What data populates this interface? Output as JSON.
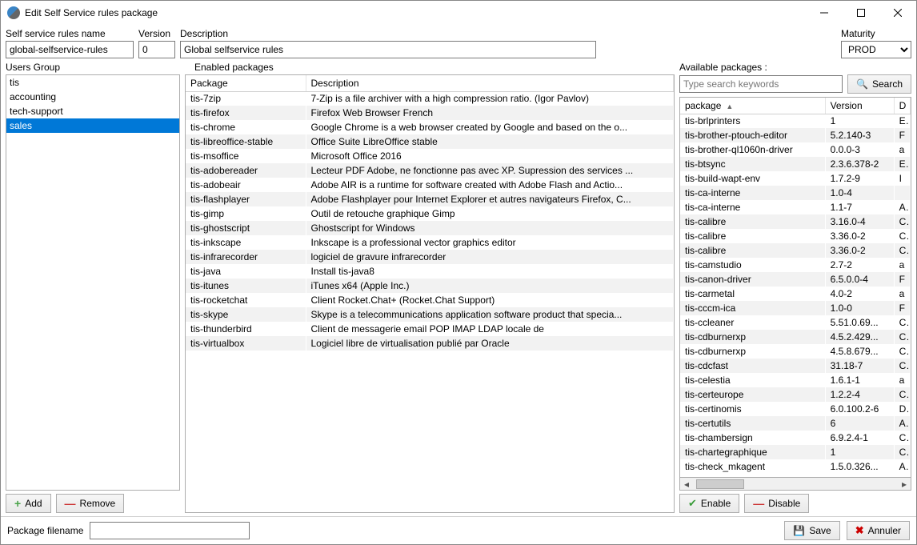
{
  "window": {
    "title": "Edit Self Service rules package"
  },
  "header": {
    "name_label": "Self service rules name",
    "name_value": "global-selfservice-rules",
    "version_label": "Version",
    "version_value": "0",
    "description_label": "Description",
    "description_value": "Global selfservice rules",
    "maturity_label": "Maturity",
    "maturity_value": "PROD"
  },
  "left": {
    "title": "Users Group",
    "items": [
      "tis",
      "accounting",
      "tech-support",
      "sales"
    ],
    "selected": "sales",
    "add_label": "Add",
    "remove_label": "Remove"
  },
  "mid": {
    "title": "Enabled packages",
    "col_package": "Package",
    "col_description": "Description",
    "rows": [
      {
        "p": "tis-7zip",
        "d": "7-Zip is a file archiver with a high compression ratio. (Igor Pavlov)"
      },
      {
        "p": "tis-firefox",
        "d": "Firefox Web Browser French"
      },
      {
        "p": "tis-chrome",
        "d": "Google Chrome is a web browser created by Google and based on the o..."
      },
      {
        "p": "tis-libreoffice-stable",
        "d": "Office Suite LibreOffice stable"
      },
      {
        "p": "tis-msoffice",
        "d": "Microsoft Office 2016"
      },
      {
        "p": "tis-adobereader",
        "d": "Lecteur PDF Adobe, ne fonctionne pas avec XP. Supression des services ..."
      },
      {
        "p": "tis-adobeair",
        "d": "Adobe AIR is a runtime for software created with Adobe Flash and Actio..."
      },
      {
        "p": "tis-flashplayer",
        "d": "Adobe Flashplayer pour Internet Explorer et autres navigateurs Firefox, C..."
      },
      {
        "p": "tis-gimp",
        "d": "Outil de retouche graphique Gimp"
      },
      {
        "p": "tis-ghostscript",
        "d": "Ghostscript for Windows"
      },
      {
        "p": "tis-inkscape",
        "d": "Inkscape is a professional vector graphics editor"
      },
      {
        "p": "tis-infrarecorder",
        "d": "logiciel de gravure infrarecorder"
      },
      {
        "p": "tis-java",
        "d": "Install tis-java8"
      },
      {
        "p": "tis-itunes",
        "d": "iTunes x64 (Apple Inc.)"
      },
      {
        "p": "tis-rocketchat",
        "d": "Client Rocket.Chat+ (Rocket.Chat Support)"
      },
      {
        "p": "tis-skype",
        "d": "Skype is a telecommunications application software product that specia..."
      },
      {
        "p": "tis-thunderbird",
        "d": "Client de messagerie email POP IMAP LDAP locale de"
      },
      {
        "p": "tis-virtualbox",
        "d": "Logiciel libre de virtualisation publié par Oracle"
      }
    ]
  },
  "right": {
    "title": "Available packages :",
    "search_placeholder": "Type search keywords",
    "search_label": "Search",
    "col_package": "package",
    "col_version": "Version",
    "col_d": "D",
    "rows": [
      {
        "p": "tis-brlprinters",
        "v": "1",
        "d": "E"
      },
      {
        "p": "tis-brother-ptouch-editor",
        "v": "5.2.140-3",
        "d": "F"
      },
      {
        "p": "tis-brother-ql1060n-driver",
        "v": "0.0.0-3",
        "d": "a"
      },
      {
        "p": "tis-btsync",
        "v": "2.3.6.378-2",
        "d": "E"
      },
      {
        "p": "tis-build-wapt-env",
        "v": "1.7.2-9",
        "d": "I"
      },
      {
        "p": "tis-ca-interne",
        "v": "1.0-4",
        "d": ""
      },
      {
        "p": "tis-ca-interne",
        "v": "1.1-7",
        "d": "A"
      },
      {
        "p": "tis-calibre",
        "v": "3.16.0-4",
        "d": "C"
      },
      {
        "p": "tis-calibre",
        "v": "3.36.0-2",
        "d": "C"
      },
      {
        "p": "tis-calibre",
        "v": "3.36.0-2",
        "d": "C"
      },
      {
        "p": "tis-camstudio",
        "v": "2.7-2",
        "d": "a"
      },
      {
        "p": "tis-canon-driver",
        "v": "6.5.0.0-4",
        "d": "F"
      },
      {
        "p": "tis-carmetal",
        "v": "4.0-2",
        "d": "a"
      },
      {
        "p": "tis-cccm-ica",
        "v": "1.0-0",
        "d": "F"
      },
      {
        "p": "tis-ccleaner",
        "v": "5.51.0.69...",
        "d": "C"
      },
      {
        "p": "tis-cdburnerxp",
        "v": "4.5.2.429...",
        "d": "C"
      },
      {
        "p": "tis-cdburnerxp",
        "v": "4.5.8.679...",
        "d": "C"
      },
      {
        "p": "tis-cdcfast",
        "v": "31.18-7",
        "d": "C"
      },
      {
        "p": "tis-celestia",
        "v": "1.6.1-1",
        "d": "a"
      },
      {
        "p": "tis-certeurope",
        "v": "1.2.2-4",
        "d": "C"
      },
      {
        "p": "tis-certinomis",
        "v": "6.0.100.2-6",
        "d": "D"
      },
      {
        "p": "tis-certutils",
        "v": "6",
        "d": "A"
      },
      {
        "p": "tis-chambersign",
        "v": "6.9.2.4-1",
        "d": "C"
      },
      {
        "p": "tis-chartegraphique",
        "v": "1",
        "d": "C"
      },
      {
        "p": "tis-check_mkagent",
        "v": "1.5.0.326...",
        "d": "A"
      }
    ],
    "enable_label": "Enable",
    "disable_label": "Disable"
  },
  "footer": {
    "pkg_filename_label": "Package filename",
    "pkg_filename_value": "",
    "save_label": "Save",
    "cancel_label": "Annuler"
  }
}
